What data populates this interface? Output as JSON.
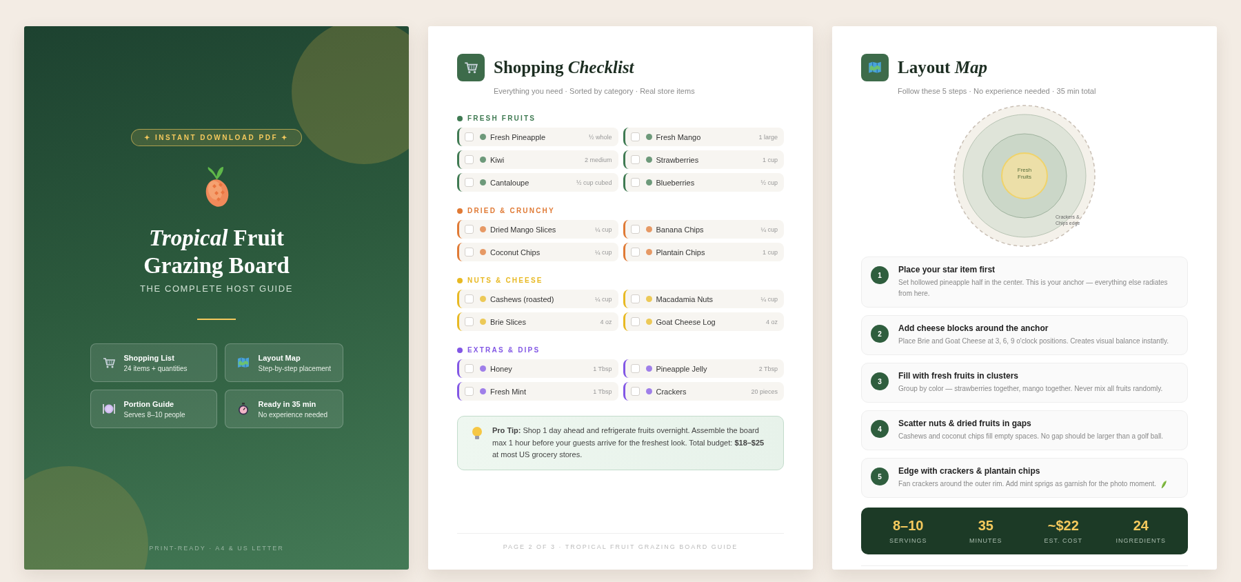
{
  "cover": {
    "badge": "✦ INSTANT DOWNLOAD PDF ✦",
    "title_line1": "*Tropical* Fruit",
    "title_line2": "Grazing Board",
    "subtitle": "THE COMPLETE HOST GUIDE",
    "features": [
      {
        "kind": "cart",
        "title": "Shopping List",
        "detail": "24 items + quantities"
      },
      {
        "kind": "map",
        "title": "Layout Map",
        "detail": "Step-by-step placement"
      },
      {
        "kind": "plate",
        "title": "Portion Guide",
        "detail": "Serves 8–10 people"
      },
      {
        "kind": "stopwatch",
        "title": "Ready in 35 min",
        "detail": "No experience needed"
      }
    ],
    "footer": "PRINT-READY · A4 & US LETTER"
  },
  "checklist": {
    "title": "Shopping *Checklist*",
    "subtitle": "Everything you need · Sorted by category · Real store items",
    "categories": [
      {
        "name": "FRESH FRUITS",
        "color": "#3f7a52",
        "items": [
          {
            "name": "Fresh Pineapple",
            "quantity": "½ whole",
            "checked": false
          },
          {
            "name": "Fresh Mango",
            "quantity": "1 large",
            "checked": false
          },
          {
            "name": "Kiwi",
            "quantity": "2 medium",
            "checked": false
          },
          {
            "name": "Strawberries",
            "quantity": "1 cup",
            "checked": false
          },
          {
            "name": "Cantaloupe",
            "quantity": "½ cup cubed",
            "checked": false
          },
          {
            "name": "Blueberries",
            "quantity": "½ cup",
            "checked": false
          }
        ]
      },
      {
        "name": "DRIED & CRUNCHY",
        "color": "#e07a35",
        "items": [
          {
            "name": "Dried Mango Slices",
            "quantity": "¼ cup",
            "checked": false
          },
          {
            "name": "Banana Chips",
            "quantity": "¼ cup",
            "checked": false
          },
          {
            "name": "Coconut Chips",
            "quantity": "¼ cup",
            "checked": false
          },
          {
            "name": "Plantain Chips",
            "quantity": "1 cup",
            "checked": false
          }
        ]
      },
      {
        "name": "NUTS & CHEESE",
        "color": "#e8b923",
        "items": [
          {
            "name": "Cashews (roasted)",
            "quantity": "¼ cup",
            "checked": false
          },
          {
            "name": "Macadamia Nuts",
            "quantity": "¼ cup",
            "checked": false
          },
          {
            "name": "Brie Slices",
            "quantity": "4 oz",
            "checked": false
          },
          {
            "name": "Goat Cheese Log",
            "quantity": "4 oz",
            "checked": false
          }
        ]
      },
      {
        "name": "EXTRAS & DIPS",
        "color": "#8257e5",
        "items": [
          {
            "name": "Honey",
            "quantity": "1 Tbsp",
            "checked": false
          },
          {
            "name": "Pineapple Jelly",
            "quantity": "2 Tbsp",
            "checked": false
          },
          {
            "name": "Fresh Mint",
            "quantity": "1 Tbsp",
            "checked": false
          },
          {
            "name": "Crackers",
            "quantity": "20 pieces",
            "checked": false
          }
        ]
      }
    ],
    "tip": "**Pro Tip:** Shop 1 day ahead and refrigerate fruits overnight. Assemble the board max 1 hour before your guests arrive for the freshest look. Total budget: **$18–$25** at most US grocery stores.",
    "footer": "PAGE 2 OF 3 · TROPICAL FRUIT GRAZING BOARD GUIDE"
  },
  "layout_map": {
    "title": "Layout *Map*",
    "subtitle": "Follow these 5 steps · No experience needed · 35 min total",
    "diagram": {
      "center_label": "Fresh Fruits",
      "edge_label": "Crackers & Chips edge"
    },
    "steps": [
      {
        "number": "1",
        "title": "Place your star item first",
        "text": "Set hollowed pineapple half in the center. This is your anchor — everything else radiates from here."
      },
      {
        "number": "2",
        "title": "Add cheese blocks around the anchor",
        "text": "Place Brie and Goat Cheese at 3, 6, 9 o'clock positions. Creates visual balance instantly."
      },
      {
        "number": "3",
        "title": "Fill with fresh fruits in clusters",
        "text": "Group by color — strawberries together, mango together. Never mix all fruits randomly."
      },
      {
        "number": "4",
        "title": "Scatter nuts & dried fruits in gaps",
        "text": "Cashews and coconut chips fill empty spaces. No gap should be larger than a golf ball."
      },
      {
        "number": "5",
        "title": "Edge with crackers & plantain chips",
        "text": "Fan crackers around the outer rim. Add mint sprigs as garnish for the photo moment.",
        "kind": "garnish"
      }
    ],
    "stats": [
      {
        "value": "8–10",
        "label": "SERVINGS"
      },
      {
        "value": "35",
        "label": "MINUTES"
      },
      {
        "value": "~$22",
        "label": "EST. COST"
      },
      {
        "value": "24",
        "label": "INGREDIENTS"
      }
    ]
  }
}
